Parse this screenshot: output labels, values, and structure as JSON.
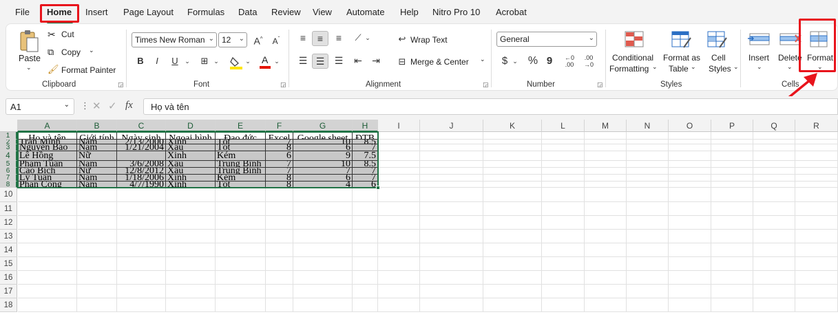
{
  "menu": {
    "tabs": [
      "File",
      "Home",
      "Insert",
      "Page Layout",
      "Formulas",
      "Data",
      "Review",
      "View",
      "Automate",
      "Help",
      "Nitro Pro 10",
      "Acrobat"
    ],
    "active": "Home"
  },
  "clipboard": {
    "paste": "Paste",
    "cut": "Cut",
    "copy": "Copy",
    "format_painter": "Format Painter",
    "label": "Clipboard"
  },
  "font": {
    "name": "Times New Roman",
    "size": "12",
    "label": "Font",
    "bold": "B",
    "italic": "I",
    "underline": "U"
  },
  "alignment": {
    "wrap_text": "Wrap Text",
    "merge_center": "Merge & Center",
    "label": "Alignment"
  },
  "number": {
    "format": "General",
    "label": "Number",
    "currency": "$",
    "percent": "%",
    "comma": "9"
  },
  "styles": {
    "conditional_1": "Conditional",
    "conditional_2": "Formatting",
    "format_table_1": "Format as",
    "format_table_2": "Table",
    "cell_styles_1": "Cell",
    "cell_styles_2": "Styles",
    "label": "Styles"
  },
  "cells": {
    "insert": "Insert",
    "delete": "Delete",
    "format": "Format",
    "label": "Cells"
  },
  "formula_bar": {
    "name_box": "A1",
    "fx": "fx",
    "content": "Họ và tên"
  },
  "columns": [
    "A",
    "B",
    "C",
    "D",
    "E",
    "F",
    "G",
    "H",
    "I",
    "J",
    "K",
    "L",
    "M",
    "N",
    "O",
    "P",
    "Q",
    "R"
  ],
  "rows": [
    "1",
    "2",
    "3",
    "4",
    "5",
    "6",
    "7",
    "8",
    "10",
    "11",
    "12",
    "13",
    "14",
    "15",
    "16",
    "17",
    "18"
  ],
  "table": {
    "headers": [
      "Họ và tên",
      "Giới tính",
      "Ngày sinh",
      "Ngoại hình",
      "Đạo đức",
      "Excel",
      "Google sheet",
      "ĐTB"
    ],
    "rows": [
      [
        "Trần Minh",
        "Nam",
        "2/13/2000",
        "Xinh",
        "Tốt",
        "7",
        "10",
        "8.5"
      ],
      [
        "Nguyễn Bảo",
        "Nam",
        "1/21/2004",
        "Xấu",
        "Tốt",
        "8",
        "6",
        "7"
      ],
      [
        "Lê Hồng",
        "Nữ",
        "",
        "Xinh",
        "Kém",
        "6",
        "9",
        "7.5"
      ],
      [
        "Phạm Tuấn",
        "Nam",
        "3/6/2008",
        "Xấu",
        "Trung Bình",
        "7",
        "10",
        "8.5"
      ],
      [
        "Cao Bích",
        "Nữ",
        "12/8/2012",
        "Xấu",
        "Trung Bình",
        "7",
        "7",
        "7"
      ],
      [
        "Lý Tuấn",
        "Nam",
        "1/18/2006",
        "Xinh",
        "Kém",
        "8",
        "6",
        "7"
      ],
      [
        "Phan Công",
        "Nam",
        "4/7/1990",
        "Xinh",
        "Tốt",
        "8",
        "4",
        "6"
      ]
    ]
  }
}
